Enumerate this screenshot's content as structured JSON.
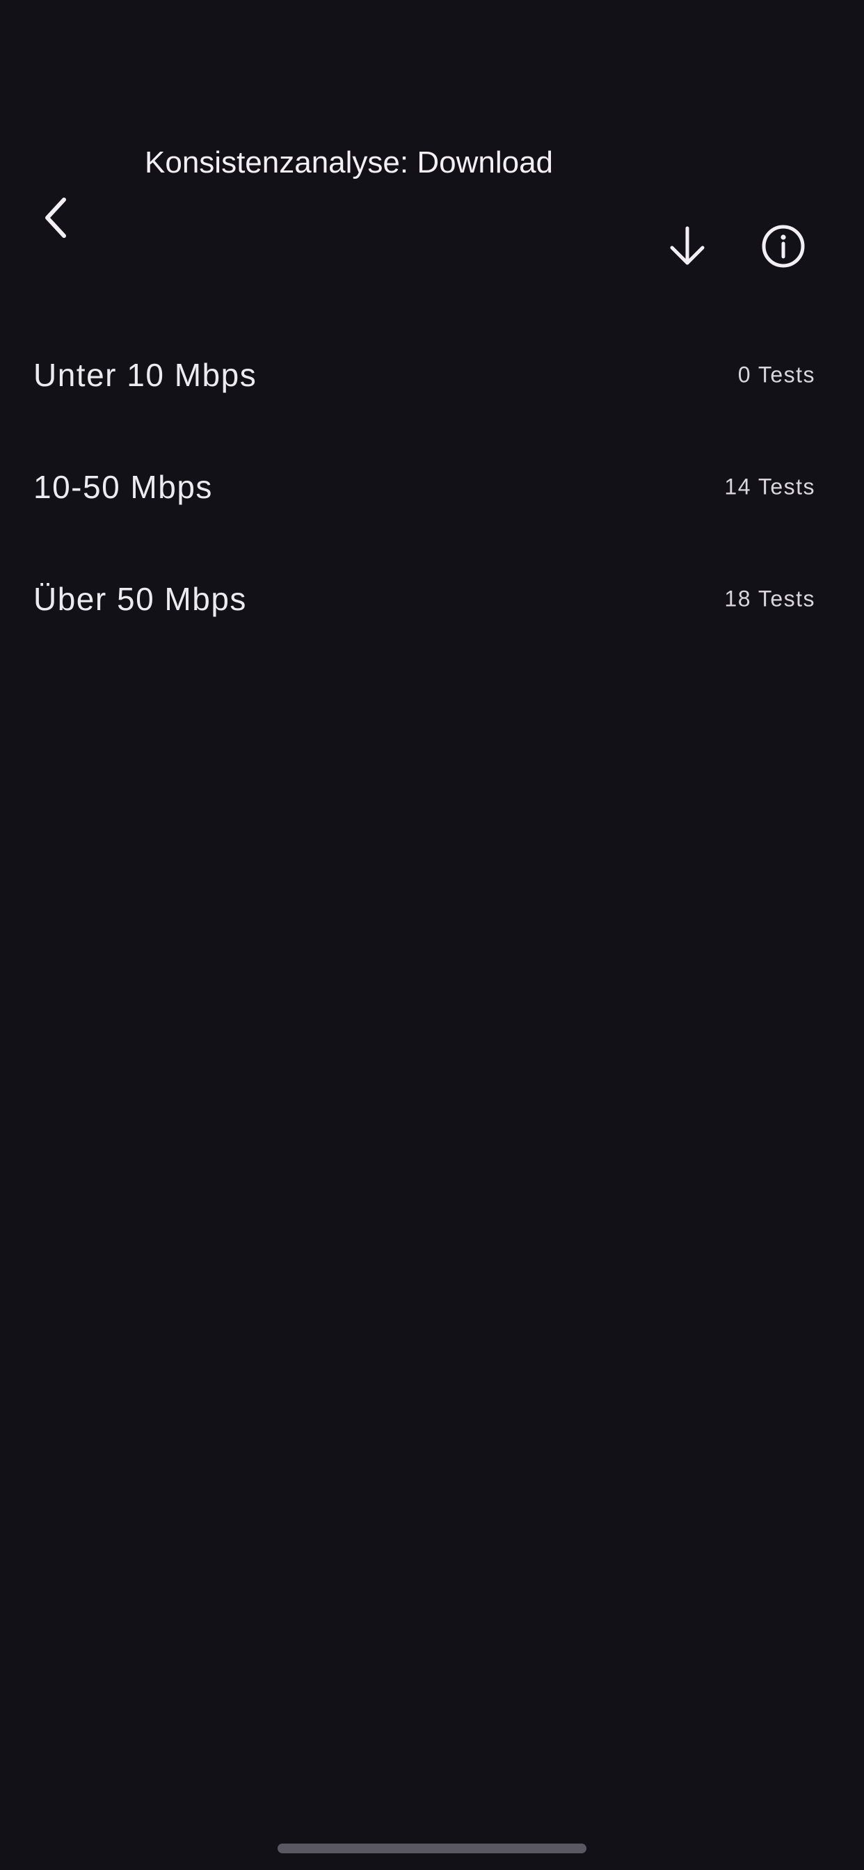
{
  "header": {
    "title": "Konsistenzanalyse: Download",
    "back_icon": "chevron-left-icon",
    "download_icon": "arrow-down-icon",
    "info_icon": "info-circle-icon"
  },
  "list": {
    "items": [
      {
        "label": "Unter 10 Mbps",
        "count": "0 Tests"
      },
      {
        "label": "10-50 Mbps",
        "count": "14 Tests"
      },
      {
        "label": "Über 50 Mbps",
        "count": "18 Tests"
      }
    ]
  },
  "colors": {
    "background": "#131118",
    "text": "#ecebef",
    "secondary_text": "#d9d7dd",
    "home_indicator": "#5a5860"
  }
}
